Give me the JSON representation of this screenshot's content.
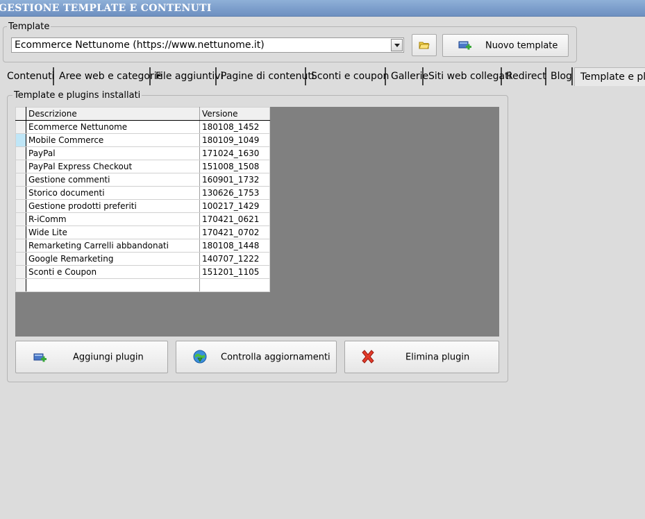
{
  "window": {
    "title": "GESTIONE TEMPLATE E CONTENUTI"
  },
  "template_group": {
    "label": "Template",
    "selected": "Ecommerce Nettunome (https://www.nettunome.it)",
    "new_button": "Nuovo template"
  },
  "tabs": [
    {
      "label": "Contenuti"
    },
    {
      "label": "Aree web e categorie"
    },
    {
      "label": "File aggiuntivi"
    },
    {
      "label": "Pagine di contenuti"
    },
    {
      "label": "Sconti e coupon"
    },
    {
      "label": "Gallerie"
    },
    {
      "label": "Siti web collegati"
    },
    {
      "label": "Redirect"
    },
    {
      "label": "Blog"
    },
    {
      "label": "Template e plug"
    }
  ],
  "plugins_group": {
    "label": "Template e plugins installati",
    "columns": {
      "description": "Descrizione",
      "version": "Versione"
    },
    "rows": [
      {
        "description": "Ecommerce Nettunome",
        "version": "180108_1452"
      },
      {
        "description": "Mobile Commerce",
        "version": "180109_1049"
      },
      {
        "description": "PayPal",
        "version": "171024_1630"
      },
      {
        "description": "PayPal Express Checkout",
        "version": "151008_1508"
      },
      {
        "description": "Gestione commenti",
        "version": "160901_1732"
      },
      {
        "description": "Storico documenti",
        "version": "130626_1753"
      },
      {
        "description": "Gestione prodotti preferiti",
        "version": "100217_1429"
      },
      {
        "description": "R-iComm",
        "version": "170421_0621"
      },
      {
        "description": "Wide Lite",
        "version": "170421_0702"
      },
      {
        "description": "Remarketing Carrelli abbandonati",
        "version": "180108_1448"
      },
      {
        "description": "Google Remarketing",
        "version": "140707_1222"
      },
      {
        "description": "Sconti e Coupon",
        "version": "151201_1105"
      }
    ],
    "buttons": {
      "add": "Aggiungi plugin",
      "check": "Controlla aggiornamenti",
      "delete": "Elimina plugin"
    }
  },
  "colors": {
    "titlebar": "#7a9cca",
    "grid_background": "#808080",
    "selected_row_marker": "#bfe6f7"
  }
}
